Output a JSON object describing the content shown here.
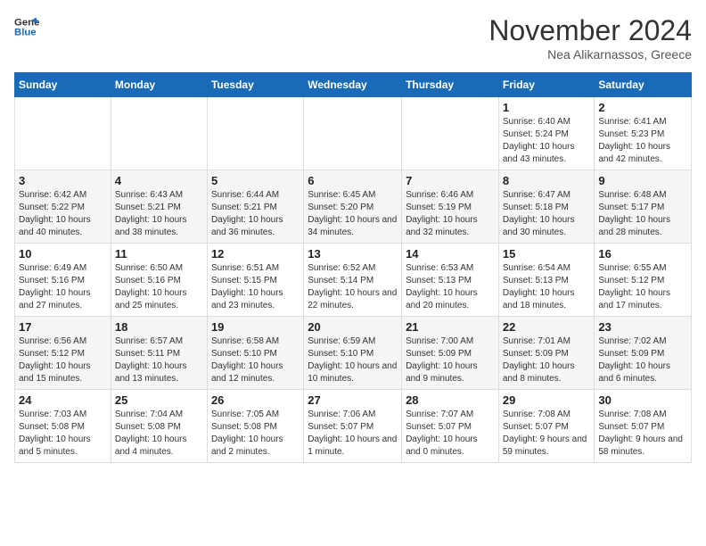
{
  "logo": {
    "line1": "General",
    "line2": "Blue"
  },
  "title": "November 2024",
  "subtitle": "Nea Alikarnassos, Greece",
  "days_of_week": [
    "Sunday",
    "Monday",
    "Tuesday",
    "Wednesday",
    "Thursday",
    "Friday",
    "Saturday"
  ],
  "weeks": [
    [
      {
        "day": "",
        "info": ""
      },
      {
        "day": "",
        "info": ""
      },
      {
        "day": "",
        "info": ""
      },
      {
        "day": "",
        "info": ""
      },
      {
        "day": "",
        "info": ""
      },
      {
        "day": "1",
        "info": "Sunrise: 6:40 AM\nSunset: 5:24 PM\nDaylight: 10 hours and 43 minutes."
      },
      {
        "day": "2",
        "info": "Sunrise: 6:41 AM\nSunset: 5:23 PM\nDaylight: 10 hours and 42 minutes."
      }
    ],
    [
      {
        "day": "3",
        "info": "Sunrise: 6:42 AM\nSunset: 5:22 PM\nDaylight: 10 hours and 40 minutes."
      },
      {
        "day": "4",
        "info": "Sunrise: 6:43 AM\nSunset: 5:21 PM\nDaylight: 10 hours and 38 minutes."
      },
      {
        "day": "5",
        "info": "Sunrise: 6:44 AM\nSunset: 5:21 PM\nDaylight: 10 hours and 36 minutes."
      },
      {
        "day": "6",
        "info": "Sunrise: 6:45 AM\nSunset: 5:20 PM\nDaylight: 10 hours and 34 minutes."
      },
      {
        "day": "7",
        "info": "Sunrise: 6:46 AM\nSunset: 5:19 PM\nDaylight: 10 hours and 32 minutes."
      },
      {
        "day": "8",
        "info": "Sunrise: 6:47 AM\nSunset: 5:18 PM\nDaylight: 10 hours and 30 minutes."
      },
      {
        "day": "9",
        "info": "Sunrise: 6:48 AM\nSunset: 5:17 PM\nDaylight: 10 hours and 28 minutes."
      }
    ],
    [
      {
        "day": "10",
        "info": "Sunrise: 6:49 AM\nSunset: 5:16 PM\nDaylight: 10 hours and 27 minutes."
      },
      {
        "day": "11",
        "info": "Sunrise: 6:50 AM\nSunset: 5:16 PM\nDaylight: 10 hours and 25 minutes."
      },
      {
        "day": "12",
        "info": "Sunrise: 6:51 AM\nSunset: 5:15 PM\nDaylight: 10 hours and 23 minutes."
      },
      {
        "day": "13",
        "info": "Sunrise: 6:52 AM\nSunset: 5:14 PM\nDaylight: 10 hours and 22 minutes."
      },
      {
        "day": "14",
        "info": "Sunrise: 6:53 AM\nSunset: 5:13 PM\nDaylight: 10 hours and 20 minutes."
      },
      {
        "day": "15",
        "info": "Sunrise: 6:54 AM\nSunset: 5:13 PM\nDaylight: 10 hours and 18 minutes."
      },
      {
        "day": "16",
        "info": "Sunrise: 6:55 AM\nSunset: 5:12 PM\nDaylight: 10 hours and 17 minutes."
      }
    ],
    [
      {
        "day": "17",
        "info": "Sunrise: 6:56 AM\nSunset: 5:12 PM\nDaylight: 10 hours and 15 minutes."
      },
      {
        "day": "18",
        "info": "Sunrise: 6:57 AM\nSunset: 5:11 PM\nDaylight: 10 hours and 13 minutes."
      },
      {
        "day": "19",
        "info": "Sunrise: 6:58 AM\nSunset: 5:10 PM\nDaylight: 10 hours and 12 minutes."
      },
      {
        "day": "20",
        "info": "Sunrise: 6:59 AM\nSunset: 5:10 PM\nDaylight: 10 hours and 10 minutes."
      },
      {
        "day": "21",
        "info": "Sunrise: 7:00 AM\nSunset: 5:09 PM\nDaylight: 10 hours and 9 minutes."
      },
      {
        "day": "22",
        "info": "Sunrise: 7:01 AM\nSunset: 5:09 PM\nDaylight: 10 hours and 8 minutes."
      },
      {
        "day": "23",
        "info": "Sunrise: 7:02 AM\nSunset: 5:09 PM\nDaylight: 10 hours and 6 minutes."
      }
    ],
    [
      {
        "day": "24",
        "info": "Sunrise: 7:03 AM\nSunset: 5:08 PM\nDaylight: 10 hours and 5 minutes."
      },
      {
        "day": "25",
        "info": "Sunrise: 7:04 AM\nSunset: 5:08 PM\nDaylight: 10 hours and 4 minutes."
      },
      {
        "day": "26",
        "info": "Sunrise: 7:05 AM\nSunset: 5:08 PM\nDaylight: 10 hours and 2 minutes."
      },
      {
        "day": "27",
        "info": "Sunrise: 7:06 AM\nSunset: 5:07 PM\nDaylight: 10 hours and 1 minute."
      },
      {
        "day": "28",
        "info": "Sunrise: 7:07 AM\nSunset: 5:07 PM\nDaylight: 10 hours and 0 minutes."
      },
      {
        "day": "29",
        "info": "Sunrise: 7:08 AM\nSunset: 5:07 PM\nDaylight: 9 hours and 59 minutes."
      },
      {
        "day": "30",
        "info": "Sunrise: 7:08 AM\nSunset: 5:07 PM\nDaylight: 9 hours and 58 minutes."
      }
    ]
  ]
}
